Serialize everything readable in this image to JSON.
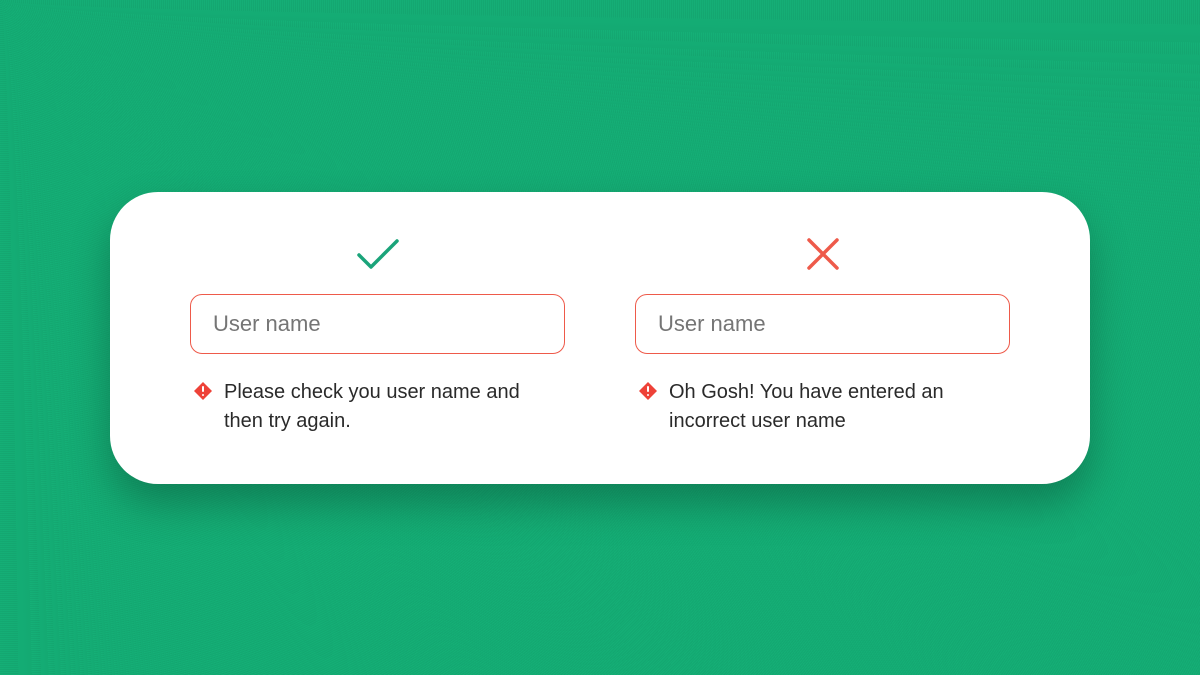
{
  "colors": {
    "background": "#15b278",
    "card": "#ffffff",
    "border_error": "#ee5a4a",
    "check": "#1aa47a",
    "cross": "#ee5a4a",
    "alert": "#ee4238",
    "text": "#2a2a2a"
  },
  "good": {
    "input_placeholder": "User name",
    "error_message": "Please check you user name and then try again."
  },
  "bad": {
    "input_placeholder": "User name",
    "error_message": "Oh Gosh! You have entered an incorrect user name"
  }
}
